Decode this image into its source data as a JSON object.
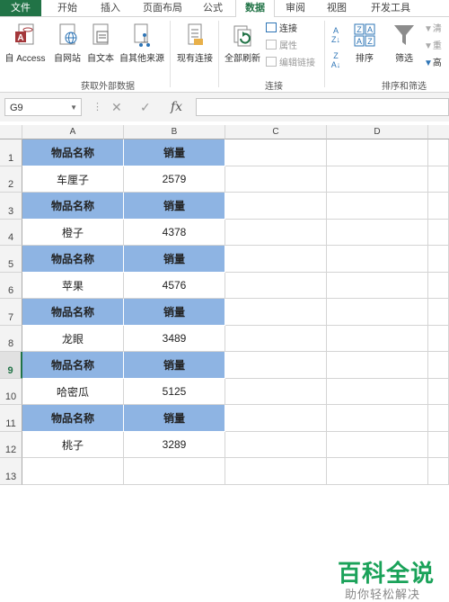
{
  "tabs": [
    "文件",
    "开始",
    "插入",
    "页面布局",
    "公式",
    "数据",
    "审阅",
    "视图",
    "开发工具"
  ],
  "ribbon": {
    "get_external": {
      "buttons": [
        "自 Access",
        "自网站",
        "自文本",
        "自其他来源"
      ],
      "group_label": "获取外部数据"
    },
    "existing": "现有连接",
    "connections": {
      "refresh_all": "全部刷新",
      "items": [
        "连接",
        "属性",
        "编辑链接"
      ],
      "group_label": "连接"
    },
    "sort_filter": {
      "sort": "排序",
      "filter": "筛选",
      "side_items": [
        "清",
        "重",
        "高"
      ],
      "group_label": "排序和筛选"
    }
  },
  "formula_bar": {
    "name_box": "G9",
    "fx_label": "fx",
    "formula": ""
  },
  "columns": [
    "A",
    "B",
    "C",
    "D"
  ],
  "rows": [
    "1",
    "2",
    "3",
    "4",
    "5",
    "6",
    "7",
    "8",
    "9",
    "10",
    "11",
    "12",
    "13"
  ],
  "selected_row": "9",
  "cells": [
    [
      "物品名称",
      "销量"
    ],
    [
      "车厘子",
      "2579"
    ],
    [
      "物品名称",
      "销量"
    ],
    [
      "橙子",
      "4378"
    ],
    [
      "物品名称",
      "销量"
    ],
    [
      "苹果",
      "4576"
    ],
    [
      "物品名称",
      "销量"
    ],
    [
      "龙眼",
      "3489"
    ],
    [
      "物品名称",
      "销量"
    ],
    [
      "哈密瓜",
      "5125"
    ],
    [
      "物品名称",
      "销量"
    ],
    [
      "桃子",
      "3289"
    ],
    [
      "",
      ""
    ]
  ],
  "watermark": {
    "title": "百科全说",
    "subtitle": "助你轻松解决"
  },
  "colors": {
    "accent": "#217346",
    "header_fill": "#8eb4e3",
    "watermark": "#1aa259"
  }
}
